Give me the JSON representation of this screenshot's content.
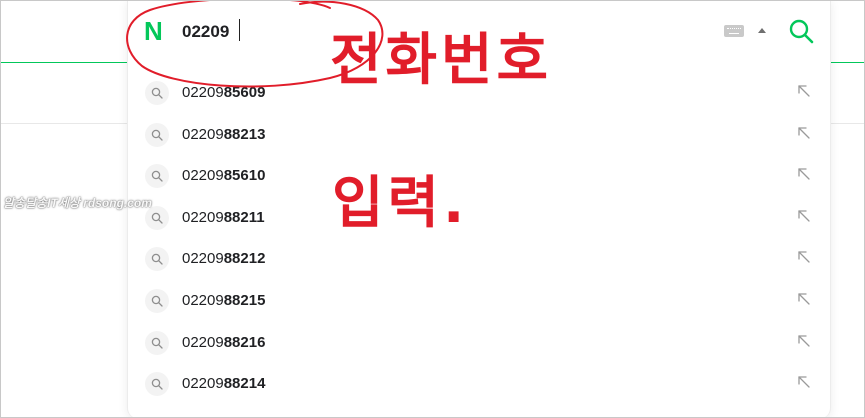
{
  "search": {
    "logo": "N",
    "query": "02209"
  },
  "suggestions": [
    {
      "prefix": "02209",
      "suffix": "85609"
    },
    {
      "prefix": "02209",
      "suffix": "88213"
    },
    {
      "prefix": "02209",
      "suffix": "85610"
    },
    {
      "prefix": "02209",
      "suffix": "88211"
    },
    {
      "prefix": "02209",
      "suffix": "88212"
    },
    {
      "prefix": "02209",
      "suffix": "88215"
    },
    {
      "prefix": "02209",
      "suffix": "88216"
    },
    {
      "prefix": "02209",
      "suffix": "88214"
    }
  ],
  "annotations": {
    "line1": "전화번호",
    "line2": "입력."
  },
  "watermark": "알송달송IT세상 rdsong.com",
  "colors": {
    "brand_green": "#03c75a",
    "annotation_red": "#e11d2a"
  },
  "icons": {
    "logo": "naver-n-logo",
    "keyboard": "keyboard-icon",
    "toggle": "arrow-up-icon",
    "search": "search-icon",
    "item": "search-icon",
    "fill": "arrow-up-left-icon"
  }
}
